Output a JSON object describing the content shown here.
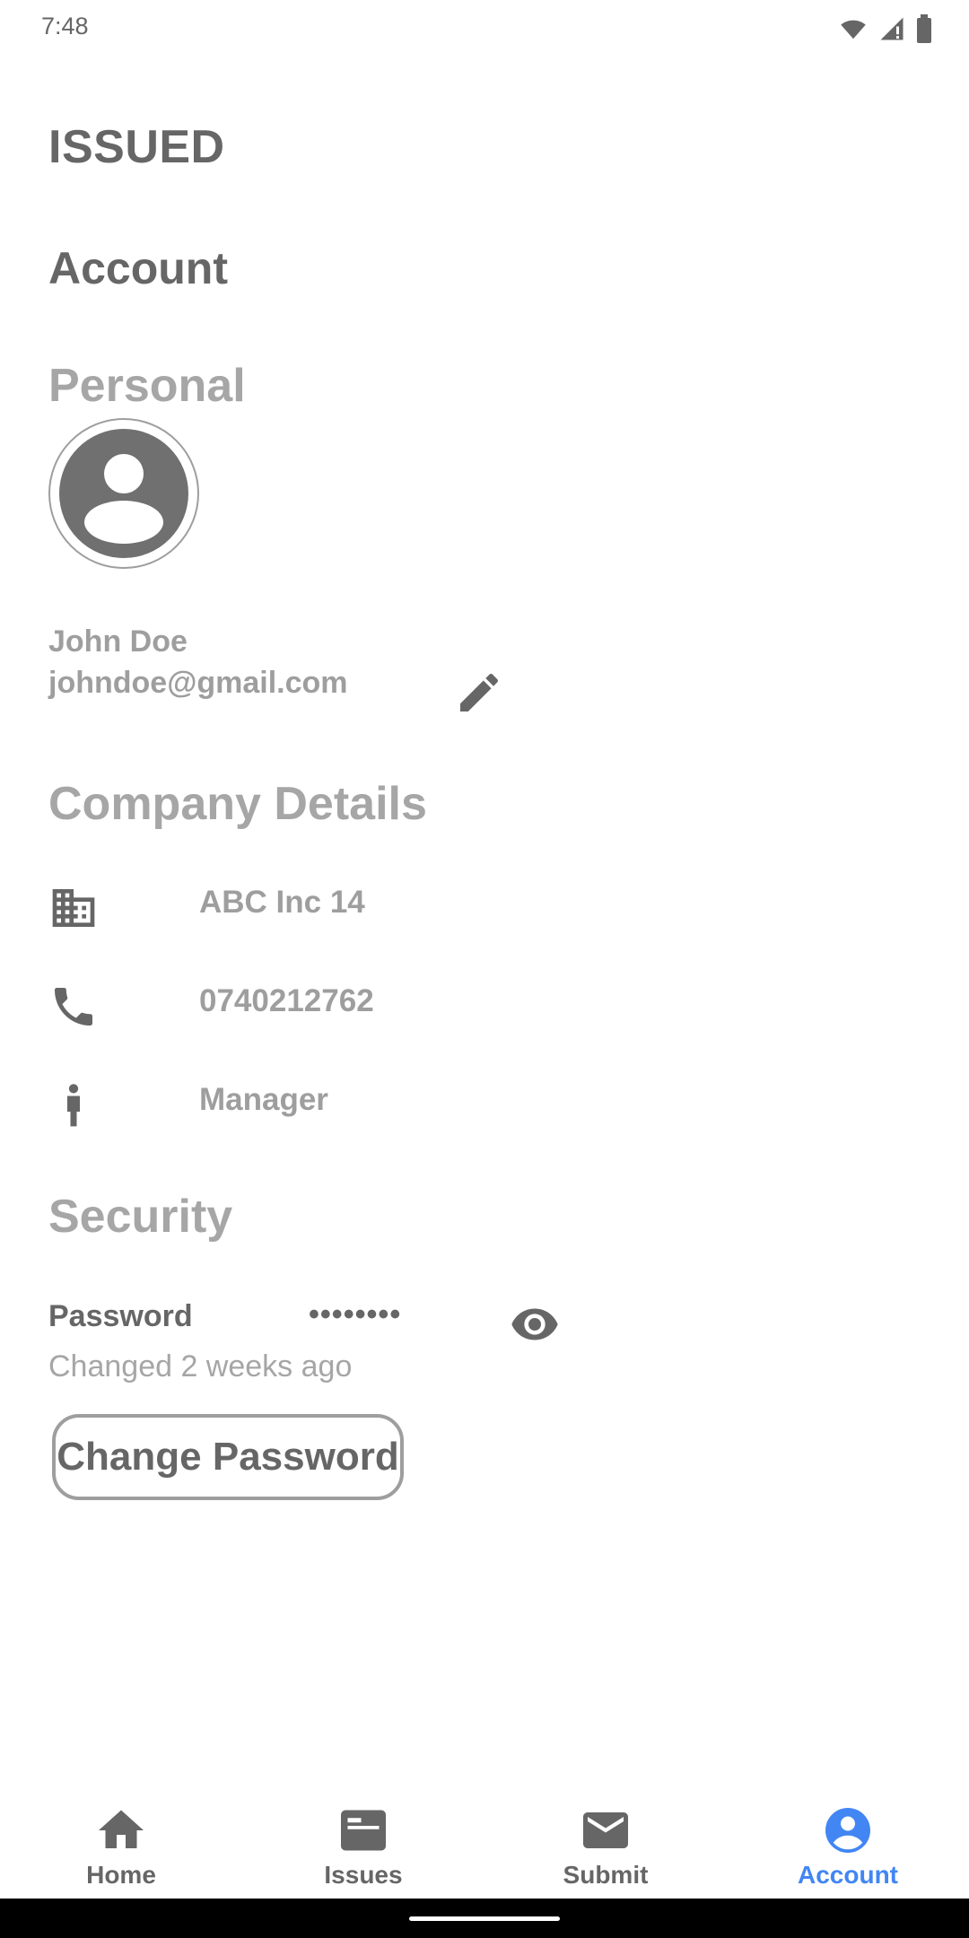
{
  "status_bar": {
    "time": "7:48"
  },
  "app_title": "ISSUED",
  "page_title": "Account",
  "personal": {
    "section_title": "Personal",
    "name": "John Doe",
    "email": "johndoe@gmail.com"
  },
  "company": {
    "section_title": "Company Details",
    "name": "ABC Inc 14",
    "phone": "0740212762",
    "role": "Manager"
  },
  "security": {
    "section_title": "Security",
    "password_label": "Password",
    "password_mask": "••••••••",
    "changed_text": "Changed 2 weeks ago",
    "change_button_label": "Change Password"
  },
  "nav": {
    "items": [
      {
        "label": "Home",
        "icon": "home-icon"
      },
      {
        "label": "Issues",
        "icon": "issues-icon"
      },
      {
        "label": "Submit",
        "icon": "mail-icon"
      },
      {
        "label": "Account",
        "icon": "account-icon"
      }
    ],
    "active_index": 3
  },
  "colors": {
    "accent": "#4286f4",
    "text_dark": "#666666",
    "text_light": "#9e9e9e"
  }
}
